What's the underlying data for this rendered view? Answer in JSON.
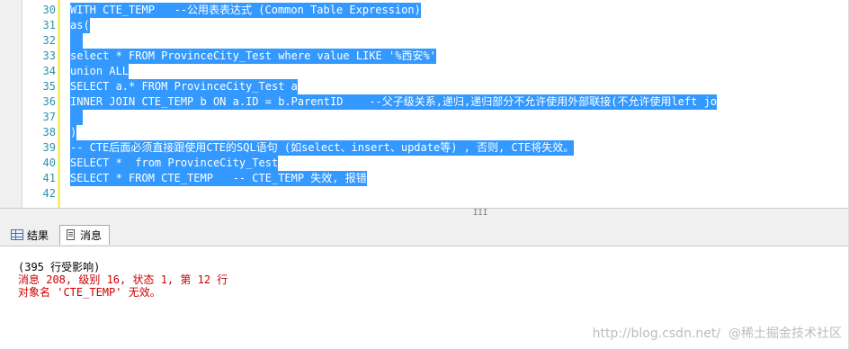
{
  "editor": {
    "lines": [
      {
        "num": "30",
        "text": "WITH CTE_TEMP   --公用表表达式 (Common Table Expression)"
      },
      {
        "num": "31",
        "text": "as("
      },
      {
        "num": "32",
        "text": ""
      },
      {
        "num": "33",
        "text": "select * FROM ProvinceCity_Test where value LIKE '%西安%'"
      },
      {
        "num": "34",
        "text": "union ALL"
      },
      {
        "num": "35",
        "text": "SELECT a.* FROM ProvinceCity_Test a"
      },
      {
        "num": "36",
        "text": "INNER JOIN CTE_TEMP b ON a.ID = b.ParentID    --父子级关系,递归,递归部分不允许使用外部联接(不允许使用left jo"
      },
      {
        "num": "37",
        "text": ""
      },
      {
        "num": "38",
        "text": ")"
      },
      {
        "num": "39",
        "text": "-- CTE后面必须直接跟使用CTE的SQL语句 (如select、insert、update等) , 否则, CTE将失效。"
      },
      {
        "num": "40",
        "text": "SELECT *  from ProvinceCity_Test"
      },
      {
        "num": "41",
        "text": "SELECT * FROM CTE_TEMP   -- CTE_TEMP 失效, 报错"
      },
      {
        "num": "42",
        "text": ""
      }
    ]
  },
  "scrollbar": {
    "grip": "III"
  },
  "tabs": {
    "results": "结果",
    "messages": "消息"
  },
  "messages": {
    "rows_affected": "(395 行受影响)",
    "error_line1": "消息 208, 级别 16, 状态 1, 第 12 行",
    "error_line2": "对象名 'CTE_TEMP' 无效。"
  },
  "watermark": "http://blog.csdn.net/  @稀土掘金技术社区",
  "colors": {
    "selection": "#3399ff",
    "line_number": "#2b91af",
    "error_text": "#cc0000"
  }
}
